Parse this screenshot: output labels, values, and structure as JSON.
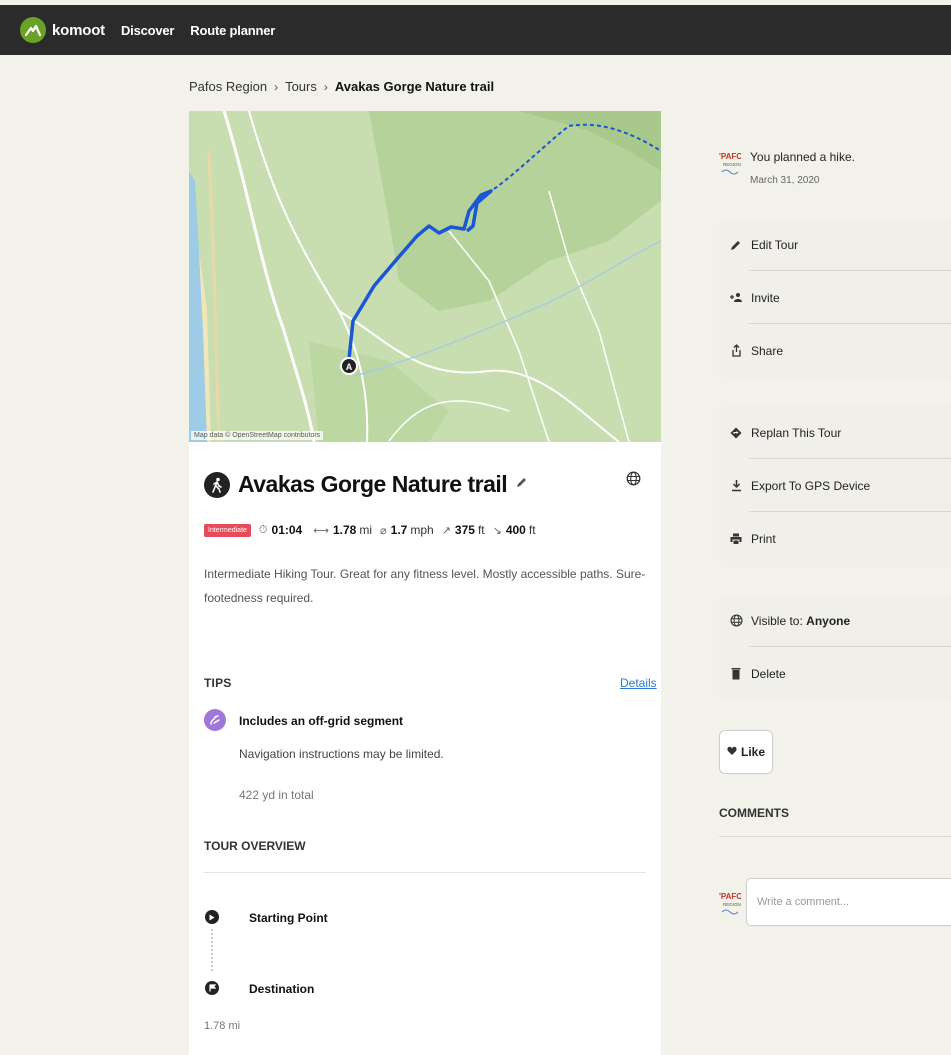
{
  "header": {
    "logo_text": "komoot",
    "nav": [
      "Discover",
      "Route planner"
    ]
  },
  "breadcrumb": {
    "items": [
      "Pafos Region",
      "Tours"
    ],
    "current": "Avakas Gorge Nature trail"
  },
  "map": {
    "attribution": "Map data © OpenStreetMap contributors",
    "start_marker": "A",
    "route_color": "#1a56d6"
  },
  "tour": {
    "title": "Avakas Gorge Nature trail",
    "difficulty": "Intermediate",
    "difficulty_color": "#e64b5a",
    "duration": "01:04",
    "distance_value": "1.78",
    "distance_unit": "mi",
    "speed_value": "1.7",
    "speed_unit": "mph",
    "uphill_value": "375",
    "uphill_unit": "ft",
    "downhill_value": "400",
    "downhill_unit": "ft",
    "description": "Intermediate Hiking Tour. Great for any fitness level. Mostly accessible paths. Sure-footedness required."
  },
  "tips": {
    "label": "TIPS",
    "details_link": "Details",
    "item_title": "Includes an off-grid segment",
    "item_text": "Navigation instructions may be limited.",
    "item_total": "422 yd in total"
  },
  "overview": {
    "label": "TOUR OVERVIEW",
    "start": "Starting Point",
    "destination": "Destination",
    "distance": "1.78 mi"
  },
  "activity": {
    "avatar_text": "PAFOS REGION",
    "message": "You planned a hike.",
    "date": "March 31, 2020"
  },
  "actions_group1": [
    "Edit Tour",
    "Invite",
    "Share"
  ],
  "actions_group2": [
    "Replan This Tour",
    "Export To GPS Device",
    "Print"
  ],
  "actions_group3": {
    "visible_prefix": "Visible to: ",
    "visible_value": "Anyone",
    "delete": "Delete"
  },
  "like": {
    "label": "Like"
  },
  "comments": {
    "label": "COMMENTS",
    "placeholder": "Write a comment..."
  }
}
